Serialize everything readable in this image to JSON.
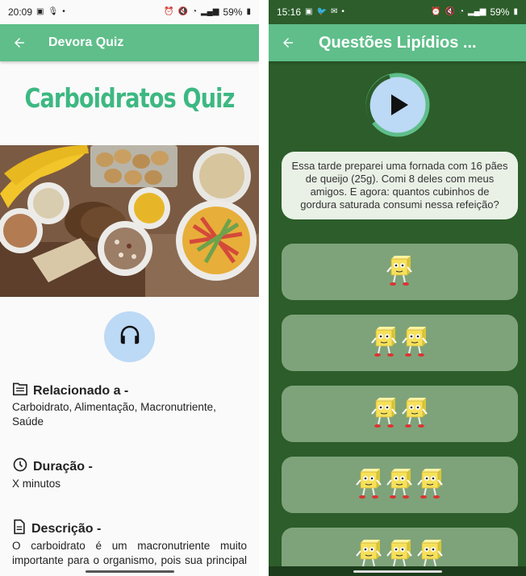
{
  "left": {
    "status": {
      "time": "20:09",
      "battery": "59%"
    },
    "appbar": {
      "title": "Devora Quiz"
    },
    "quiz_title": "Carboidratos Quiz",
    "related": {
      "heading": "Relacionado a -",
      "text": "Carboidrato, Alimentação, Macronutriente, Saúde"
    },
    "duration": {
      "heading": "Duração -",
      "text": "X minutos"
    },
    "description": {
      "heading": "Descrição -",
      "text": "O carboidrato é um macronutriente muito importante para o organismo, pois sua principal função é proporcionar energia"
    },
    "icons": {
      "back": "arrow-left-icon",
      "audio": "headphones-icon",
      "related": "folder-icon",
      "duration": "clock-icon",
      "description": "document-icon"
    }
  },
  "right": {
    "status": {
      "time": "15:16",
      "battery": "59%"
    },
    "appbar": {
      "title": "Questões Lipídios ..."
    },
    "question": "Essa tarde preparei uma fornada com 16 pães de queijo (25g). Comi 8 deles com meus amigos. E agora: quantos cubinhos de gordura saturada consumi nessa refeição?",
    "answers": [
      {
        "cubes": 1
      },
      {
        "cubes": 2
      },
      {
        "cubes": 2
      },
      {
        "cubes": 3
      },
      {
        "cubes": 3
      }
    ],
    "icons": {
      "back": "arrow-left-icon",
      "play": "play-icon",
      "cube": "butter-cube-character-icon"
    }
  },
  "colors": {
    "primary": "#5fbe8a",
    "title_green": "#3db882",
    "dark_green": "#2c5d2a",
    "answer_green": "#7ea37a",
    "audio_blue": "#bcd9f5"
  }
}
